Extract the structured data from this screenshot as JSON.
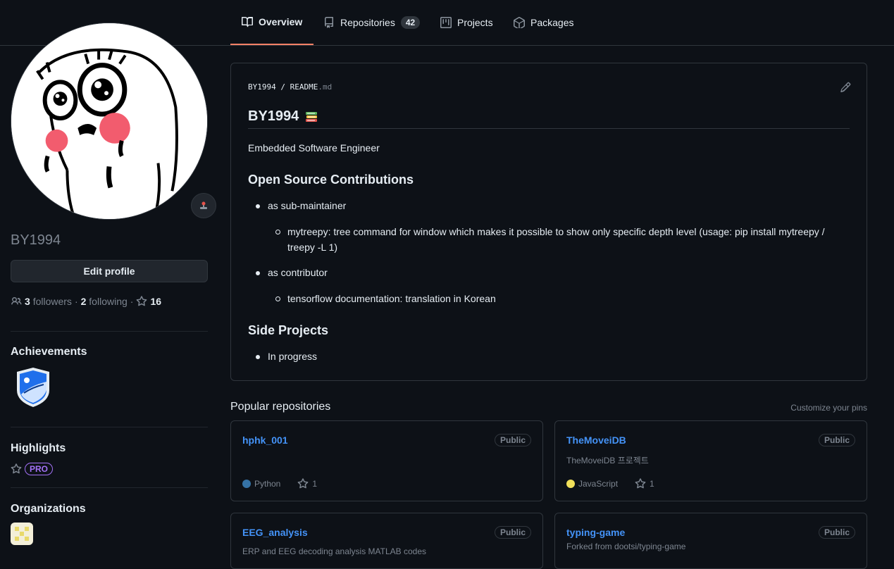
{
  "nav": {
    "tabs": [
      {
        "label": "Overview",
        "icon": "book-icon"
      },
      {
        "label": "Repositories",
        "icon": "repo-icon",
        "count": "42"
      },
      {
        "label": "Projects",
        "icon": "project-icon"
      },
      {
        "label": "Packages",
        "icon": "package-icon"
      }
    ]
  },
  "profile": {
    "username": "BY1994",
    "edit_label": "Edit profile",
    "followers_count": "3",
    "followers_label": "followers",
    "following_count": "2",
    "following_label": "following",
    "stars_count": "16",
    "achievements_title": "Achievements",
    "highlights_title": "Highlights",
    "pro_label": "PRO",
    "organizations_title": "Organizations"
  },
  "readme": {
    "owner": "BY1994",
    "sep": "/",
    "file": "README",
    "ext": ".md",
    "title": "BY1994",
    "tagline": "Embedded Software Engineer",
    "section1": "Open Source Contributions",
    "item1": "as sub-maintainer",
    "item1_sub_line1": "mytreepy: tree command for window which makes it possible to show only specific depth level (usage: pip install mytreepy /",
    "item1_sub_line2": "treepy -L 1)",
    "item2": "as contributor",
    "item2_sub": "tensorflow documentation: translation in Korean",
    "section2": "Side Projects",
    "item3": "In progress"
  },
  "popular": {
    "title": "Popular repositories",
    "customize": "Customize your pins",
    "repos": [
      {
        "name": "hphk_001",
        "visibility": "Public",
        "description": "",
        "language": "Python",
        "lang_color": "#3572A5",
        "stars": "1"
      },
      {
        "name": "TheMoveiDB",
        "visibility": "Public",
        "description": "TheMoveiDB 프로젝트",
        "language": "JavaScript",
        "lang_color": "#f1e05a",
        "stars": "1"
      },
      {
        "name": "EEG_analysis",
        "visibility": "Public",
        "description": "ERP and EEG decoding analysis MATLAB codes",
        "language": "",
        "stars": ""
      },
      {
        "name": "typing-game",
        "visibility": "Public",
        "description": "Forked from dootsi/typing-game",
        "language": "",
        "stars": ""
      }
    ]
  },
  "colors": {
    "accent": "#f78166",
    "link": "#4493f8",
    "pro": "#a371f7",
    "bg": "#0d1117"
  }
}
